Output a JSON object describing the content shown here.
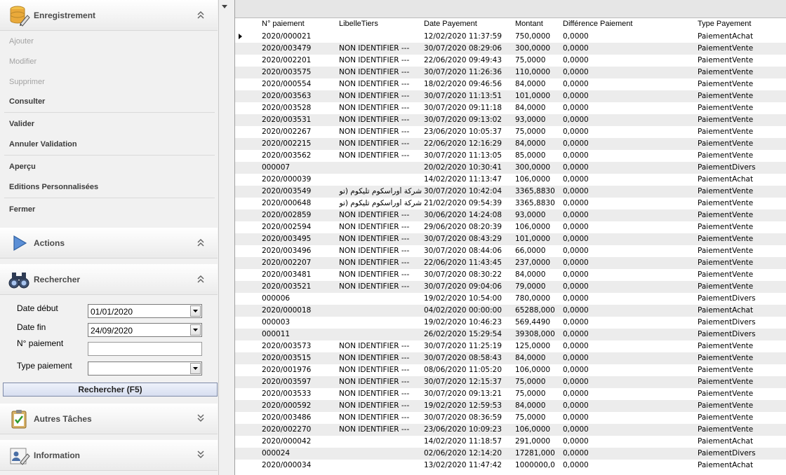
{
  "sidebar": {
    "enregistrement": {
      "title": "Enregistrement",
      "items": [
        {
          "label": "Ajouter",
          "enabled": false
        },
        {
          "label": "Modifier",
          "enabled": false
        },
        {
          "label": "Supprimer",
          "enabled": false
        },
        {
          "label": "Consulter",
          "enabled": true
        },
        {
          "label": "Valider",
          "enabled": true
        },
        {
          "label": "Annuler Validation",
          "enabled": true
        },
        {
          "label": "Aperçu",
          "enabled": true
        },
        {
          "label": "Editions Personnalisées",
          "enabled": true
        },
        {
          "label": "Fermer",
          "enabled": true
        }
      ]
    },
    "actions": {
      "title": "Actions"
    },
    "rechercher": {
      "title": "Rechercher",
      "date_debut_label": "Date début",
      "date_debut_value": "01/01/2020",
      "date_fin_label": "Date fin",
      "date_fin_value": "24/09/2020",
      "num_paiement_label": "N° paiement",
      "num_paiement_value": "",
      "type_paiement_label": "Type paiement",
      "type_paiement_value": "",
      "button_label": "Rechercher (F5)"
    },
    "autres_taches": {
      "title": "Autres Tâches"
    },
    "information": {
      "title": "Information"
    }
  },
  "grid": {
    "columns": [
      "N° paiement",
      "LibelleTiers",
      "Date Payement",
      "Montant",
      "Différence Paiement",
      "Type Payement"
    ],
    "rows": [
      [
        "2020/000021",
        "",
        "12/02/2020 11:37:59",
        "750,0000",
        "0,0000",
        "PaiementAchat"
      ],
      [
        "2020/003479",
        "NON IDENTIFIER ---",
        "30/07/2020 08:29:06",
        "300,0000",
        "0,0000",
        "PaiementVente"
      ],
      [
        "2020/002201",
        "NON IDENTIFIER ---",
        "22/06/2020 09:49:43",
        "75,0000",
        "0,0000",
        "PaiementVente"
      ],
      [
        "2020/003575",
        "NON IDENTIFIER ---",
        "30/07/2020 11:26:36",
        "110,0000",
        "0,0000",
        "PaiementVente"
      ],
      [
        "2020/000554",
        "NON IDENTIFIER ---",
        "18/02/2020 09:46:56",
        "84,0000",
        "0,0000",
        "PaiementVente"
      ],
      [
        "2020/003563",
        "NON IDENTIFIER ---",
        "30/07/2020 11:13:51",
        "101,0000",
        "0,0000",
        "PaiementVente"
      ],
      [
        "2020/003528",
        "NON IDENTIFIER ---",
        "30/07/2020 09:11:18",
        "84,0000",
        "0,0000",
        "PaiementVente"
      ],
      [
        "2020/003531",
        "NON IDENTIFIER ---",
        "30/07/2020 09:13:02",
        "93,0000",
        "0,0000",
        "PaiementVente"
      ],
      [
        "2020/002267",
        "NON IDENTIFIER ---",
        "23/06/2020 10:05:37",
        "75,0000",
        "0,0000",
        "PaiementVente"
      ],
      [
        "2020/002215",
        "NON IDENTIFIER ---",
        "22/06/2020 12:16:29",
        "84,0000",
        "0,0000",
        "PaiementVente"
      ],
      [
        "2020/003562",
        "NON IDENTIFIER ---",
        "30/07/2020 11:13:05",
        "85,0000",
        "0,0000",
        "PaiementVente"
      ],
      [
        "000007",
        "",
        "20/02/2020 10:30:41",
        "300,0000",
        "0,0000",
        "PaiementDivers"
      ],
      [
        "2020/000039",
        "",
        "14/02/2020 11:13:47",
        "106,0000",
        "0,0000",
        "PaiementAchat"
      ],
      [
        "2020/003549",
        "شركة أوراسكوم تليكوم (تونس",
        "30/07/2020 10:42:04",
        "3365,8830",
        "0,0000",
        "PaiementVente"
      ],
      [
        "2020/000648",
        "شركة أوراسكوم تليكوم (تونس",
        "21/02/2020 09:54:39",
        "3365,8830",
        "0,0000",
        "PaiementVente"
      ],
      [
        "2020/002859",
        "NON IDENTIFIER ---",
        "30/06/2020 14:24:08",
        "93,0000",
        "0,0000",
        "PaiementVente"
      ],
      [
        "2020/002594",
        "NON IDENTIFIER ---",
        "29/06/2020 08:20:39",
        "106,0000",
        "0,0000",
        "PaiementVente"
      ],
      [
        "2020/003495",
        "NON IDENTIFIER ---",
        "30/07/2020 08:43:29",
        "101,0000",
        "0,0000",
        "PaiementVente"
      ],
      [
        "2020/003496",
        "NON IDENTIFIER ---",
        "30/07/2020 08:44:06",
        "66,0000",
        "0,0000",
        "PaiementVente"
      ],
      [
        "2020/002207",
        "NON IDENTIFIER ---",
        "22/06/2020 11:43:45",
        "237,0000",
        "0,0000",
        "PaiementVente"
      ],
      [
        "2020/003481",
        "NON IDENTIFIER ---",
        "30/07/2020 08:30:22",
        "84,0000",
        "0,0000",
        "PaiementVente"
      ],
      [
        "2020/003521",
        "NON IDENTIFIER ---",
        "30/07/2020 09:04:06",
        "79,0000",
        "0,0000",
        "PaiementVente"
      ],
      [
        "000006",
        "",
        "19/02/2020 10:54:00",
        "780,0000",
        "0,0000",
        "PaiementDivers"
      ],
      [
        "2020/000018",
        "",
        "04/02/2020 00:00:00",
        "65288,000",
        "0,0000",
        "PaiementAchat"
      ],
      [
        "000003",
        "",
        "19/02/2020 10:46:23",
        "569,4490",
        "0,0000",
        "PaiementDivers"
      ],
      [
        "000011",
        "",
        "26/02/2020 15:29:54",
        "39308,000",
        "0,0000",
        "PaiementDivers"
      ],
      [
        "2020/003573",
        "NON IDENTIFIER ---",
        "30/07/2020 11:25:19",
        "125,0000",
        "0,0000",
        "PaiementVente"
      ],
      [
        "2020/003515",
        "NON IDENTIFIER ---",
        "30/07/2020 08:58:43",
        "84,0000",
        "0,0000",
        "PaiementVente"
      ],
      [
        "2020/001976",
        "NON IDENTIFIER ---",
        "08/06/2020 11:05:20",
        "106,0000",
        "0,0000",
        "PaiementVente"
      ],
      [
        "2020/003597",
        "NON IDENTIFIER ---",
        "30/07/2020 12:15:37",
        "75,0000",
        "0,0000",
        "PaiementVente"
      ],
      [
        "2020/003533",
        "NON IDENTIFIER ---",
        "30/07/2020 09:13:21",
        "75,0000",
        "0,0000",
        "PaiementVente"
      ],
      [
        "2020/000592",
        "NON IDENTIFIER ---",
        "19/02/2020 12:59:53",
        "84,0000",
        "0,0000",
        "PaiementVente"
      ],
      [
        "2020/003486",
        "NON IDENTIFIER ---",
        "30/07/2020 08:36:59",
        "75,0000",
        "0,0000",
        "PaiementVente"
      ],
      [
        "2020/002270",
        "NON IDENTIFIER ---",
        "23/06/2020 10:09:23",
        "106,0000",
        "0,0000",
        "PaiementVente"
      ],
      [
        "2020/000042",
        "",
        "14/02/2020 11:18:57",
        "291,0000",
        "0,0000",
        "PaiementAchat"
      ],
      [
        "000024",
        "",
        "02/06/2020 12:14:20",
        "17281,000",
        "0,0000",
        "PaiementDivers"
      ],
      [
        "2020/000034",
        "",
        "13/02/2020 11:47:42",
        "1000000,0",
        "0,0000",
        "PaiementAchat"
      ]
    ]
  }
}
